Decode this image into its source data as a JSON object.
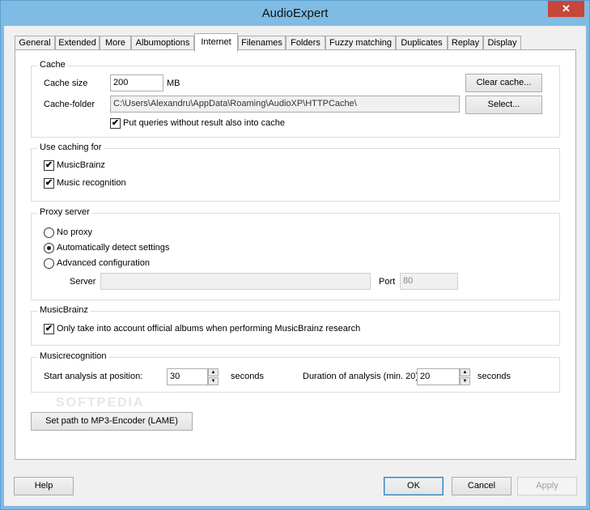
{
  "window": {
    "title": "AudioExpert",
    "close_glyph": "✕"
  },
  "tabs": [
    {
      "label": "General"
    },
    {
      "label": "Extended"
    },
    {
      "label": "More"
    },
    {
      "label": "Albumoptions"
    },
    {
      "label": "Internet"
    },
    {
      "label": "Filenames"
    },
    {
      "label": "Folders"
    },
    {
      "label": "Fuzzy matching"
    },
    {
      "label": "Duplicates"
    },
    {
      "label": "Replay"
    },
    {
      "label": "Display"
    }
  ],
  "active_tab": "Internet",
  "cache": {
    "group_title": "Cache",
    "size_label": "Cache size",
    "size_value": "200",
    "size_unit": "MB",
    "clear_button": "Clear cache...",
    "folder_label": "Cache-folder",
    "folder_value": "C:\\Users\\Alexandru\\AppData\\Roaming\\AudioXP\\HTTPCache\\",
    "select_button": "Select...",
    "put_queries_label": "Put queries without result also into cache",
    "put_queries_checked": true
  },
  "use_caching": {
    "group_title": "Use caching for",
    "musicbrainz_label": "MusicBrainz",
    "musicbrainz_checked": true,
    "recognition_label": "Music recognition",
    "recognition_checked": true
  },
  "proxy": {
    "group_title": "Proxy server",
    "options": [
      {
        "label": "No proxy",
        "selected": false
      },
      {
        "label": "Automatically detect settings",
        "selected": true
      },
      {
        "label": "Advanced configuration",
        "selected": false
      }
    ],
    "server_label": "Server",
    "server_value": "",
    "port_label": "Port",
    "port_value": "80"
  },
  "musicbrainz": {
    "group_title": "MusicBrainz",
    "official_label": "Only take into account official albums when performing MusicBrainz research",
    "official_checked": true
  },
  "musicrecognition": {
    "group_title": "Musicrecognition",
    "start_label": "Start analysis at position:",
    "start_value": "30",
    "start_unit": "seconds",
    "duration_label": "Duration of analysis (min. 20)",
    "duration_value": "20",
    "duration_unit": "seconds"
  },
  "encoder_button": "Set path to MP3-Encoder (LAME)",
  "watermark": "SOFTPEDIA",
  "footer": {
    "help": "Help",
    "ok": "OK",
    "cancel": "Cancel",
    "apply": "Apply"
  },
  "glyphs": {
    "check": "✔",
    "spin_up": "▲",
    "spin_down": "▼"
  }
}
